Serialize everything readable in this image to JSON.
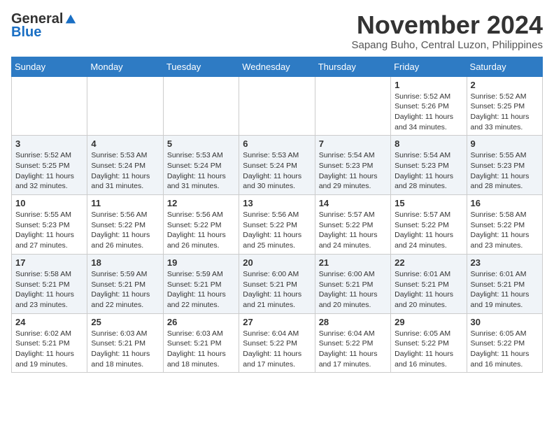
{
  "header": {
    "logo_general": "General",
    "logo_blue": "Blue",
    "month": "November 2024",
    "location": "Sapang Buho, Central Luzon, Philippines"
  },
  "days_of_week": [
    "Sunday",
    "Monday",
    "Tuesday",
    "Wednesday",
    "Thursday",
    "Friday",
    "Saturday"
  ],
  "weeks": [
    [
      {
        "day": "",
        "info": ""
      },
      {
        "day": "",
        "info": ""
      },
      {
        "day": "",
        "info": ""
      },
      {
        "day": "",
        "info": ""
      },
      {
        "day": "",
        "info": ""
      },
      {
        "day": "1",
        "info": "Sunrise: 5:52 AM\nSunset: 5:26 PM\nDaylight: 11 hours and 34 minutes."
      },
      {
        "day": "2",
        "info": "Sunrise: 5:52 AM\nSunset: 5:25 PM\nDaylight: 11 hours and 33 minutes."
      }
    ],
    [
      {
        "day": "3",
        "info": "Sunrise: 5:52 AM\nSunset: 5:25 PM\nDaylight: 11 hours and 32 minutes."
      },
      {
        "day": "4",
        "info": "Sunrise: 5:53 AM\nSunset: 5:24 PM\nDaylight: 11 hours and 31 minutes."
      },
      {
        "day": "5",
        "info": "Sunrise: 5:53 AM\nSunset: 5:24 PM\nDaylight: 11 hours and 31 minutes."
      },
      {
        "day": "6",
        "info": "Sunrise: 5:53 AM\nSunset: 5:24 PM\nDaylight: 11 hours and 30 minutes."
      },
      {
        "day": "7",
        "info": "Sunrise: 5:54 AM\nSunset: 5:23 PM\nDaylight: 11 hours and 29 minutes."
      },
      {
        "day": "8",
        "info": "Sunrise: 5:54 AM\nSunset: 5:23 PM\nDaylight: 11 hours and 28 minutes."
      },
      {
        "day": "9",
        "info": "Sunrise: 5:55 AM\nSunset: 5:23 PM\nDaylight: 11 hours and 28 minutes."
      }
    ],
    [
      {
        "day": "10",
        "info": "Sunrise: 5:55 AM\nSunset: 5:23 PM\nDaylight: 11 hours and 27 minutes."
      },
      {
        "day": "11",
        "info": "Sunrise: 5:56 AM\nSunset: 5:22 PM\nDaylight: 11 hours and 26 minutes."
      },
      {
        "day": "12",
        "info": "Sunrise: 5:56 AM\nSunset: 5:22 PM\nDaylight: 11 hours and 26 minutes."
      },
      {
        "day": "13",
        "info": "Sunrise: 5:56 AM\nSunset: 5:22 PM\nDaylight: 11 hours and 25 minutes."
      },
      {
        "day": "14",
        "info": "Sunrise: 5:57 AM\nSunset: 5:22 PM\nDaylight: 11 hours and 24 minutes."
      },
      {
        "day": "15",
        "info": "Sunrise: 5:57 AM\nSunset: 5:22 PM\nDaylight: 11 hours and 24 minutes."
      },
      {
        "day": "16",
        "info": "Sunrise: 5:58 AM\nSunset: 5:22 PM\nDaylight: 11 hours and 23 minutes."
      }
    ],
    [
      {
        "day": "17",
        "info": "Sunrise: 5:58 AM\nSunset: 5:21 PM\nDaylight: 11 hours and 23 minutes."
      },
      {
        "day": "18",
        "info": "Sunrise: 5:59 AM\nSunset: 5:21 PM\nDaylight: 11 hours and 22 minutes."
      },
      {
        "day": "19",
        "info": "Sunrise: 5:59 AM\nSunset: 5:21 PM\nDaylight: 11 hours and 22 minutes."
      },
      {
        "day": "20",
        "info": "Sunrise: 6:00 AM\nSunset: 5:21 PM\nDaylight: 11 hours and 21 minutes."
      },
      {
        "day": "21",
        "info": "Sunrise: 6:00 AM\nSunset: 5:21 PM\nDaylight: 11 hours and 20 minutes."
      },
      {
        "day": "22",
        "info": "Sunrise: 6:01 AM\nSunset: 5:21 PM\nDaylight: 11 hours and 20 minutes."
      },
      {
        "day": "23",
        "info": "Sunrise: 6:01 AM\nSunset: 5:21 PM\nDaylight: 11 hours and 19 minutes."
      }
    ],
    [
      {
        "day": "24",
        "info": "Sunrise: 6:02 AM\nSunset: 5:21 PM\nDaylight: 11 hours and 19 minutes."
      },
      {
        "day": "25",
        "info": "Sunrise: 6:03 AM\nSunset: 5:21 PM\nDaylight: 11 hours and 18 minutes."
      },
      {
        "day": "26",
        "info": "Sunrise: 6:03 AM\nSunset: 5:21 PM\nDaylight: 11 hours and 18 minutes."
      },
      {
        "day": "27",
        "info": "Sunrise: 6:04 AM\nSunset: 5:22 PM\nDaylight: 11 hours and 17 minutes."
      },
      {
        "day": "28",
        "info": "Sunrise: 6:04 AM\nSunset: 5:22 PM\nDaylight: 11 hours and 17 minutes."
      },
      {
        "day": "29",
        "info": "Sunrise: 6:05 AM\nSunset: 5:22 PM\nDaylight: 11 hours and 16 minutes."
      },
      {
        "day": "30",
        "info": "Sunrise: 6:05 AM\nSunset: 5:22 PM\nDaylight: 11 hours and 16 minutes."
      }
    ]
  ]
}
